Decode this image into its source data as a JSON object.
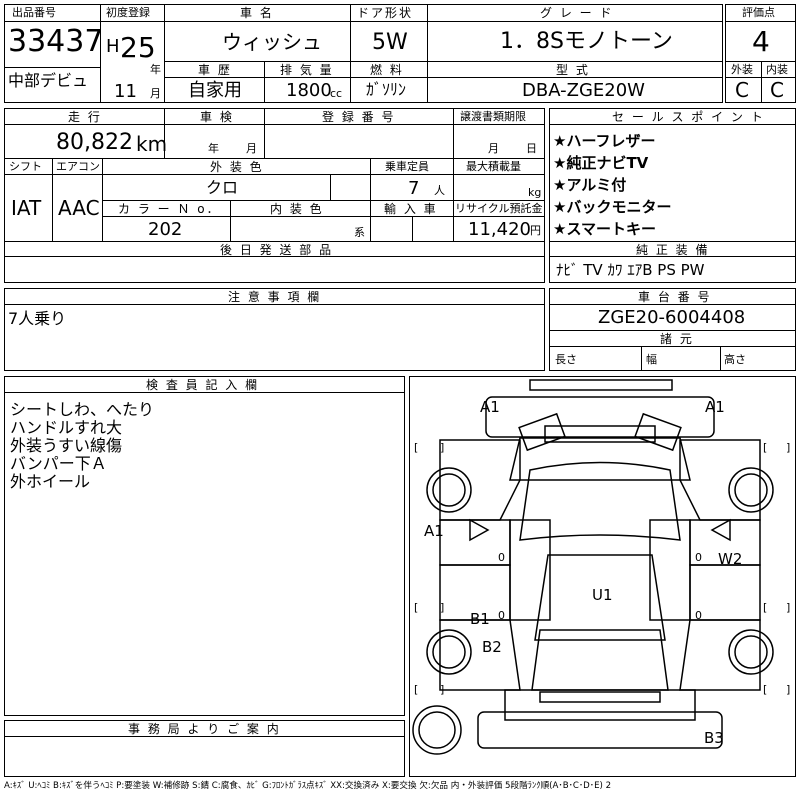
{
  "header": {
    "lot_label": "出品番号",
    "lot_number": "33437",
    "area": "中部デビュ",
    "reg_label": "初度登録",
    "era": "H",
    "year": "25",
    "year_unit": "年",
    "month": "11",
    "month_unit": "月",
    "name_label": "車 名",
    "name": "ウィッシュ",
    "history_label": "車 歴",
    "history": "自家用",
    "disp_label": "排 気 量",
    "disp": "1800",
    "disp_unit": "cc",
    "door_label": "ドア形状",
    "door": "5W",
    "fuel_label": "燃 料",
    "fuel": "ｶﾞｿﾘﾝ",
    "grade_label": "グ レ ー ド",
    "grade": "1．8Sモノトーン",
    "model_label": "型 式",
    "model": "DBA-ZGE20W",
    "score_label": "評価点",
    "score": "4",
    "ext_label": "外装",
    "ext": "C",
    "int_label": "内装",
    "int": "C"
  },
  "info": {
    "mileage_label": "走 行",
    "mileage": "80,822",
    "mileage_unit": "km",
    "inspection_label": "車 検",
    "insp_year_unit": "年",
    "insp_month_unit": "月",
    "plate_label": "登 録 番 号",
    "transfer_label": "譲渡書類期限",
    "transfer_month_unit": "月",
    "transfer_day_unit": "日",
    "shift_label": "シフト",
    "shift": "IAT",
    "ac_label": "エアコン",
    "ac": "AAC",
    "color_label": "外 装 色",
    "color": "クロ",
    "seats_label": "乗車定員",
    "seats": "7",
    "seats_unit": "人",
    "load_label": "最大積載量",
    "load_unit": "kg",
    "colorno_label": "カ ラ ー Ｎ o．",
    "colorno": "202",
    "interior_label": "内 装 色",
    "interior_unit": "系",
    "import_label": "輸 入 車",
    "recycle_label": "リサイクル預託金",
    "recycle": "11,420",
    "recycle_unit": "円",
    "later_label": "後 日 発 送 部 品"
  },
  "sales": {
    "label": "セ ー ル ス ポ イ ン ト",
    "points": [
      "★ハーフレザー",
      "★純正ナビTV",
      "★アルミ付",
      "★バックモニター",
      "★スマートキー"
    ]
  },
  "equipment": {
    "label": "純 正 装 備",
    "value": "ﾅﾋﾞ TV ｶﾜ ｴｱB PS PW"
  },
  "notes": {
    "label": "注 意 事 項 欄",
    "value": "7人乗り"
  },
  "chassis": {
    "label": "車 台 番 号",
    "value": "ZGE20-6004408",
    "dims_label": "諸 元",
    "length": "長さ",
    "width": "幅",
    "height": "高さ"
  },
  "inspector": {
    "label": "検 査 員 記 入 欄",
    "lines": [
      "シートしわ、へたり",
      "ハンドルすれ大",
      "外装うすい線傷",
      "バンパー下Ａ",
      "外ホイール"
    ]
  },
  "office": {
    "label": "事 務 局 よ り ご 案 内"
  },
  "diagram": {
    "a1_fl": "A1",
    "a1_fr": "A1",
    "a1_side": "A1",
    "w2": "W2",
    "u1": "U1",
    "b1": "B1",
    "b2": "B2",
    "b3": "B3",
    "zero": "0",
    "bl": "[",
    "br": "]"
  },
  "legend": "A:ｷｽﾞ U:ﾍｺﾐ B:ｷｽﾞを伴うﾍｺﾐ P:要塗装 W:補修跡 S:錆 C:腐食、ｶﾋﾞ G:ﾌﾛﾝﾄｶﾞﾗｽ点ｷｽﾞ XX:交換済み X:要交換 欠:欠品 内・外装評価 5段階ﾗﾝｸ順(A･B･C･D･E) 2"
}
